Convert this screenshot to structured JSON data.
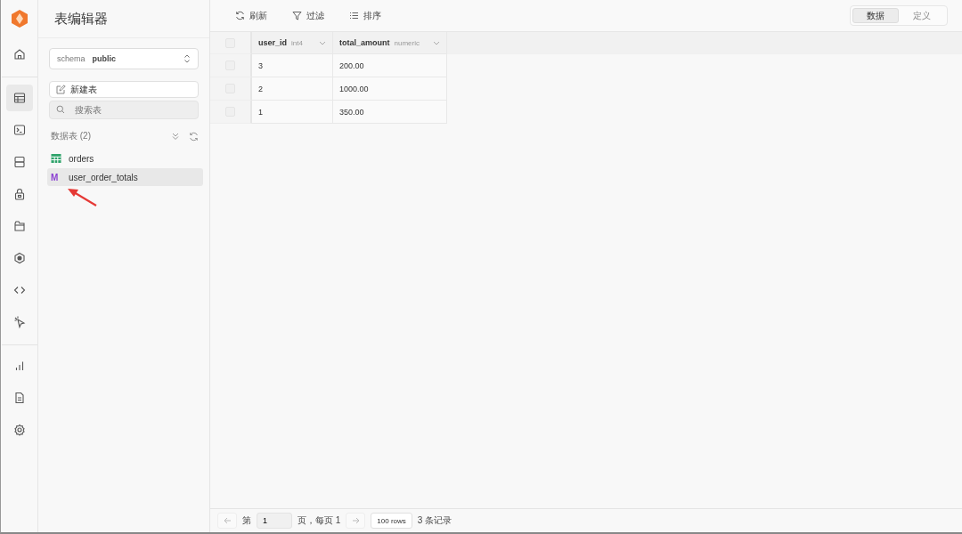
{
  "nav": [
    {
      "kind": "home",
      "selected": false
    },
    {
      "kind": "table",
      "selected": true
    },
    {
      "kind": "terminal",
      "selected": false
    },
    {
      "kind": "database",
      "selected": false
    },
    {
      "kind": "lock",
      "selected": false
    },
    {
      "kind": "folder",
      "selected": false
    },
    {
      "kind": "hexagon",
      "selected": false
    },
    {
      "kind": "code",
      "selected": false
    },
    {
      "kind": "pointer",
      "selected": false
    },
    {
      "kind": "chart",
      "selected": false
    },
    {
      "kind": "document",
      "selected": false
    },
    {
      "kind": "settings",
      "selected": false
    }
  ],
  "sidebar": {
    "title": "表编辑器",
    "schema": {
      "label": "schema",
      "value": "public"
    },
    "new_table": "新建表",
    "search": {
      "placeholder": "搜索表"
    },
    "section": "数据表 (2)",
    "items": [
      {
        "kind": "table",
        "name": "orders",
        "selected": false
      },
      {
        "kind": "view",
        "badge": "M",
        "name": "user_order_totals",
        "selected": true
      }
    ]
  },
  "toolbar": {
    "actions": [
      {
        "kind": "refresh",
        "label": "刷新"
      },
      {
        "kind": "filter",
        "label": "过滤"
      },
      {
        "kind": "sort",
        "label": "排序"
      }
    ],
    "tabs": [
      {
        "label": "数据",
        "selected": true
      },
      {
        "label": "定义",
        "selected": false
      }
    ]
  },
  "table": {
    "select_all": {
      "checked": false
    },
    "row_checked": [
      false,
      false,
      false
    ],
    "columns": [
      {
        "name": "user_id",
        "type": "int4"
      },
      {
        "name": "total_amount",
        "type": "numeric"
      }
    ],
    "rows": [
      [
        "3",
        "200.00"
      ],
      [
        "2",
        "1000.00"
      ],
      [
        "1",
        "350.00"
      ]
    ]
  },
  "footer": {
    "page_prefix": "第",
    "page": "1",
    "page_suffix": "页，每页 1",
    "rows_per_page": "100 rows",
    "count": "3 条记录"
  }
}
